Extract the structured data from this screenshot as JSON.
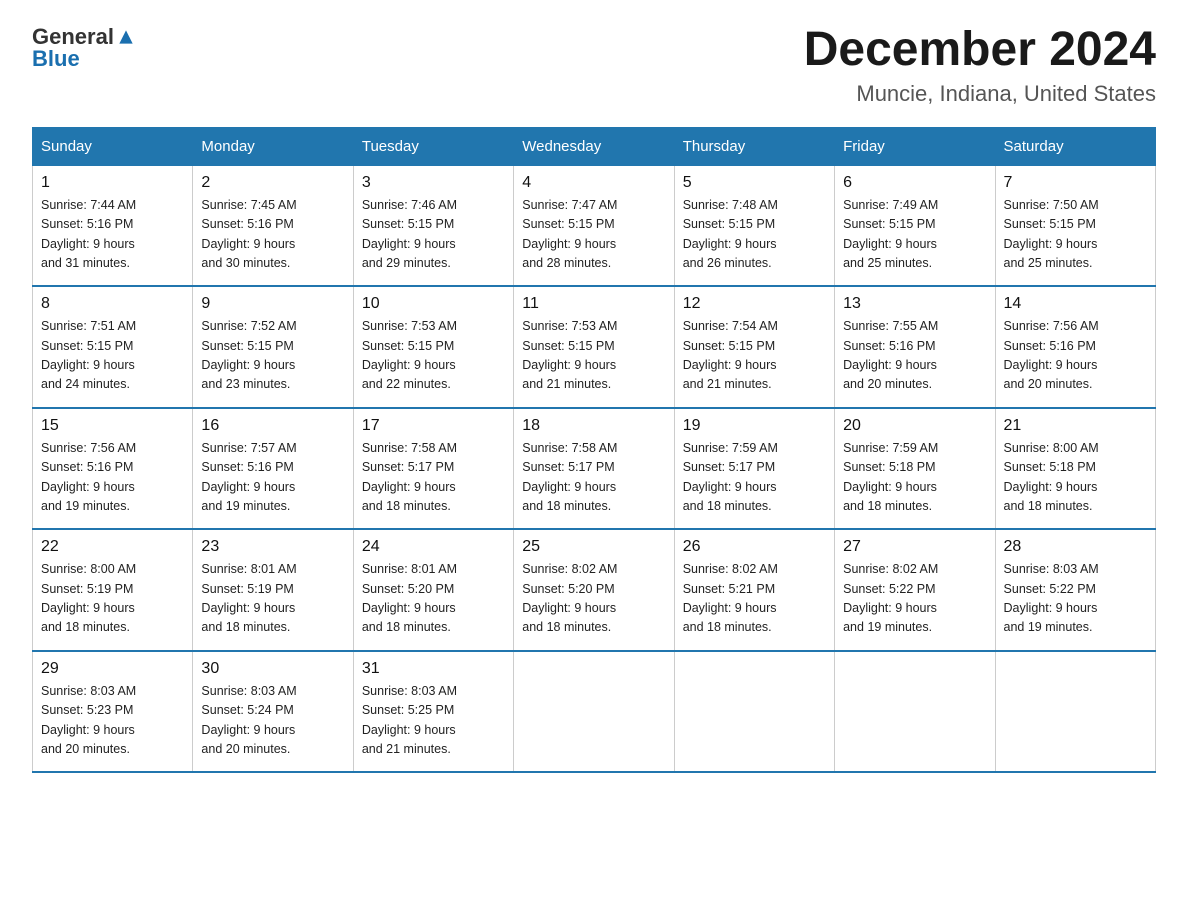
{
  "header": {
    "logo_general": "General",
    "logo_blue": "Blue",
    "month": "December 2024",
    "location": "Muncie, Indiana, United States"
  },
  "weekdays": [
    "Sunday",
    "Monday",
    "Tuesday",
    "Wednesday",
    "Thursday",
    "Friday",
    "Saturday"
  ],
  "weeks": [
    [
      {
        "day": "1",
        "info": "Sunrise: 7:44 AM\nSunset: 5:16 PM\nDaylight: 9 hours\nand 31 minutes."
      },
      {
        "day": "2",
        "info": "Sunrise: 7:45 AM\nSunset: 5:16 PM\nDaylight: 9 hours\nand 30 minutes."
      },
      {
        "day": "3",
        "info": "Sunrise: 7:46 AM\nSunset: 5:15 PM\nDaylight: 9 hours\nand 29 minutes."
      },
      {
        "day": "4",
        "info": "Sunrise: 7:47 AM\nSunset: 5:15 PM\nDaylight: 9 hours\nand 28 minutes."
      },
      {
        "day": "5",
        "info": "Sunrise: 7:48 AM\nSunset: 5:15 PM\nDaylight: 9 hours\nand 26 minutes."
      },
      {
        "day": "6",
        "info": "Sunrise: 7:49 AM\nSunset: 5:15 PM\nDaylight: 9 hours\nand 25 minutes."
      },
      {
        "day": "7",
        "info": "Sunrise: 7:50 AM\nSunset: 5:15 PM\nDaylight: 9 hours\nand 25 minutes."
      }
    ],
    [
      {
        "day": "8",
        "info": "Sunrise: 7:51 AM\nSunset: 5:15 PM\nDaylight: 9 hours\nand 24 minutes."
      },
      {
        "day": "9",
        "info": "Sunrise: 7:52 AM\nSunset: 5:15 PM\nDaylight: 9 hours\nand 23 minutes."
      },
      {
        "day": "10",
        "info": "Sunrise: 7:53 AM\nSunset: 5:15 PM\nDaylight: 9 hours\nand 22 minutes."
      },
      {
        "day": "11",
        "info": "Sunrise: 7:53 AM\nSunset: 5:15 PM\nDaylight: 9 hours\nand 21 minutes."
      },
      {
        "day": "12",
        "info": "Sunrise: 7:54 AM\nSunset: 5:15 PM\nDaylight: 9 hours\nand 21 minutes."
      },
      {
        "day": "13",
        "info": "Sunrise: 7:55 AM\nSunset: 5:16 PM\nDaylight: 9 hours\nand 20 minutes."
      },
      {
        "day": "14",
        "info": "Sunrise: 7:56 AM\nSunset: 5:16 PM\nDaylight: 9 hours\nand 20 minutes."
      }
    ],
    [
      {
        "day": "15",
        "info": "Sunrise: 7:56 AM\nSunset: 5:16 PM\nDaylight: 9 hours\nand 19 minutes."
      },
      {
        "day": "16",
        "info": "Sunrise: 7:57 AM\nSunset: 5:16 PM\nDaylight: 9 hours\nand 19 minutes."
      },
      {
        "day": "17",
        "info": "Sunrise: 7:58 AM\nSunset: 5:17 PM\nDaylight: 9 hours\nand 18 minutes."
      },
      {
        "day": "18",
        "info": "Sunrise: 7:58 AM\nSunset: 5:17 PM\nDaylight: 9 hours\nand 18 minutes."
      },
      {
        "day": "19",
        "info": "Sunrise: 7:59 AM\nSunset: 5:17 PM\nDaylight: 9 hours\nand 18 minutes."
      },
      {
        "day": "20",
        "info": "Sunrise: 7:59 AM\nSunset: 5:18 PM\nDaylight: 9 hours\nand 18 minutes."
      },
      {
        "day": "21",
        "info": "Sunrise: 8:00 AM\nSunset: 5:18 PM\nDaylight: 9 hours\nand 18 minutes."
      }
    ],
    [
      {
        "day": "22",
        "info": "Sunrise: 8:00 AM\nSunset: 5:19 PM\nDaylight: 9 hours\nand 18 minutes."
      },
      {
        "day": "23",
        "info": "Sunrise: 8:01 AM\nSunset: 5:19 PM\nDaylight: 9 hours\nand 18 minutes."
      },
      {
        "day": "24",
        "info": "Sunrise: 8:01 AM\nSunset: 5:20 PM\nDaylight: 9 hours\nand 18 minutes."
      },
      {
        "day": "25",
        "info": "Sunrise: 8:02 AM\nSunset: 5:20 PM\nDaylight: 9 hours\nand 18 minutes."
      },
      {
        "day": "26",
        "info": "Sunrise: 8:02 AM\nSunset: 5:21 PM\nDaylight: 9 hours\nand 18 minutes."
      },
      {
        "day": "27",
        "info": "Sunrise: 8:02 AM\nSunset: 5:22 PM\nDaylight: 9 hours\nand 19 minutes."
      },
      {
        "day": "28",
        "info": "Sunrise: 8:03 AM\nSunset: 5:22 PM\nDaylight: 9 hours\nand 19 minutes."
      }
    ],
    [
      {
        "day": "29",
        "info": "Sunrise: 8:03 AM\nSunset: 5:23 PM\nDaylight: 9 hours\nand 20 minutes."
      },
      {
        "day": "30",
        "info": "Sunrise: 8:03 AM\nSunset: 5:24 PM\nDaylight: 9 hours\nand 20 minutes."
      },
      {
        "day": "31",
        "info": "Sunrise: 8:03 AM\nSunset: 5:25 PM\nDaylight: 9 hours\nand 21 minutes."
      },
      {
        "day": "",
        "info": ""
      },
      {
        "day": "",
        "info": ""
      },
      {
        "day": "",
        "info": ""
      },
      {
        "day": "",
        "info": ""
      }
    ]
  ]
}
